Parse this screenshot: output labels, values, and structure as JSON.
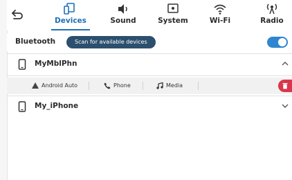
{
  "nav": {
    "tabs": [
      {
        "label": "Devices",
        "icon": "devices-icon",
        "active": true
      },
      {
        "label": "Sound",
        "icon": "speaker-icon",
        "active": false
      },
      {
        "label": "System",
        "icon": "system-icon",
        "active": false
      },
      {
        "label": "Wi-Fi",
        "icon": "wifi-icon",
        "active": false
      },
      {
        "label": "Radio",
        "icon": "radio-icon",
        "active": false
      }
    ]
  },
  "bluetooth": {
    "label": "Bluetooth",
    "scan_label": "Scan for available devices",
    "enabled": true
  },
  "devices": [
    {
      "name": "MyMblPhn",
      "expanded": true
    },
    {
      "name": "My_iPhone",
      "expanded": false
    }
  ],
  "device_options": [
    {
      "label": "Android Auto",
      "icon": "android-auto-icon"
    },
    {
      "label": "Phone",
      "icon": "phone-icon"
    },
    {
      "label": "Media",
      "icon": "music-note-icon"
    }
  ],
  "colors": {
    "accent": "#1d6fb7",
    "toggle": "#2f86cf",
    "scan_button": "#2c4f6e",
    "delete": "#d9364c"
  }
}
